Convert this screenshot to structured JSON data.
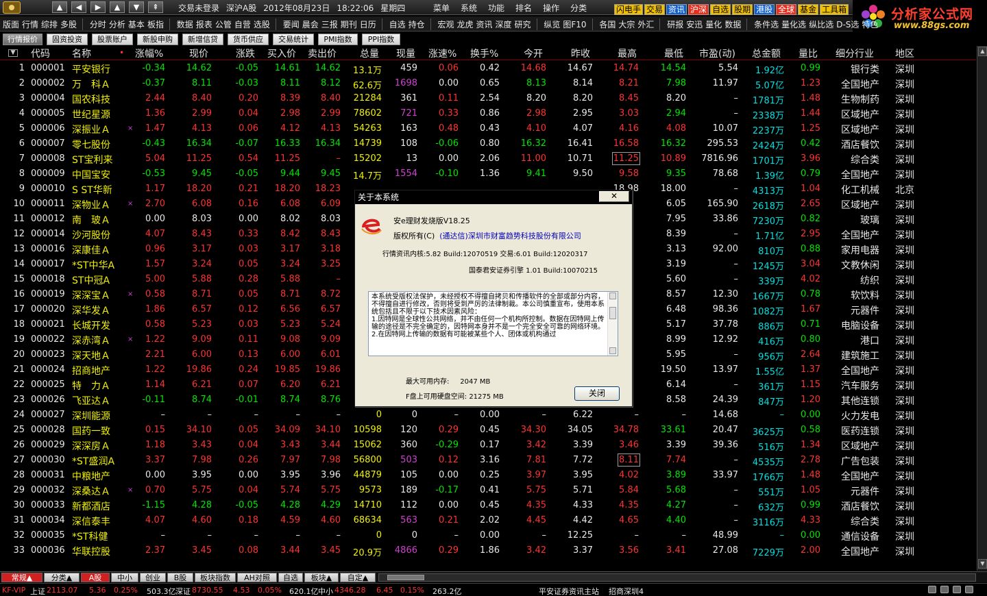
{
  "top": {
    "nav": [
      "▲",
      "◀",
      "▶",
      "▲",
      "▼",
      "⇞"
    ],
    "status": [
      "交易未登录",
      "深沪A股",
      "2012年08月23日",
      "18:22:06",
      "星期四"
    ],
    "menu": [
      "菜单",
      "系统",
      "功能",
      "排名",
      "操作",
      "分类"
    ],
    "quick": [
      "闪电手",
      "交易",
      "资讯",
      "沪深",
      "自选",
      "股期",
      "港股",
      "全球",
      "基金",
      "工具箱"
    ]
  },
  "brand": {
    "name": "分析家公式网",
    "url": "www.88gs.com",
    "logo_icon": "flower-logo-icon"
  },
  "toolbar": [
    [
      "版面",
      "行情",
      "综排",
      "多股"
    ],
    [
      "分时",
      "分析",
      "基本",
      "板指"
    ],
    [
      "数据",
      "报表",
      "公管",
      "自营",
      "选股"
    ],
    [
      "要闻",
      "晨会",
      "三报",
      "期刊",
      "日历"
    ],
    [
      "自选",
      "持仓"
    ],
    [
      "宏观",
      "龙虎",
      "资讯",
      "深度",
      "研究"
    ],
    [
      "纵览",
      "图F10"
    ],
    [
      "各国",
      "大宗",
      "外汇"
    ],
    [
      "研报",
      "安迅",
      "量化",
      "数据"
    ],
    [
      "条件选",
      "量化选",
      "纵比选",
      "D-S选",
      "特色"
    ]
  ],
  "tabs": [
    "行情报价",
    "固资投资",
    "股票账户",
    "新股申购",
    "新增信贷",
    "货币供应",
    "交易统计",
    "PMI指数",
    "PPI指数"
  ],
  "columns": [
    "代码",
    "名称",
    "涨幅%",
    "现价",
    "涨跌",
    "买入价",
    "卖出价",
    "总量",
    "现量",
    "涨速%",
    "换手%",
    "今开",
    "昨收",
    "最高",
    "最低",
    "市盈(动)",
    "总金额",
    "量比",
    "细分行业",
    "地区"
  ],
  "sort_indicator": "•",
  "rows": [
    {
      "i": "1",
      "code": "000001",
      "name": "平安银行",
      "pct": "-0.34",
      "price": "14.62",
      "chg": "-0.05",
      "buy": "14.61",
      "sell": "14.62",
      "vol": "13.1万",
      "cur": "459",
      "spd": "0.06",
      "turn": "0.42",
      "open": "14.68",
      "prev": "14.67",
      "high": "14.74",
      "low": "14.54",
      "pe": "5.54",
      "amt": "1.92亿",
      "vr": "0.99",
      "ind": "银行类",
      "reg": "深圳"
    },
    {
      "i": "2",
      "code": "000002",
      "name": "万　科Ａ",
      "pct": "-0.37",
      "price": "8.11",
      "chg": "-0.03",
      "buy": "8.11",
      "sell": "8.12",
      "vol": "62.6万",
      "cur": "1698",
      "spd": "0.00",
      "turn": "0.65",
      "open": "8.13",
      "prev": "8.14",
      "high": "8.21",
      "low": "7.98",
      "pe": "11.97",
      "amt": "5.07亿",
      "vr": "1.23",
      "ind": "全国地产",
      "reg": "深圳"
    },
    {
      "i": "3",
      "code": "000004",
      "name": "国农科技",
      "pct": "2.44",
      "price": "8.40",
      "chg": "0.20",
      "buy": "8.39",
      "sell": "8.40",
      "vol": "21284",
      "cur": "361",
      "spd": "0.11",
      "turn": "2.54",
      "open": "8.20",
      "prev": "8.20",
      "high": "8.45",
      "low": "8.20",
      "pe": "–",
      "amt": "1781万",
      "vr": "1.48",
      "ind": "生物制药",
      "reg": "深圳"
    },
    {
      "i": "4",
      "code": "000005",
      "name": "世纪星源",
      "pct": "1.36",
      "price": "2.99",
      "chg": "0.04",
      "buy": "2.98",
      "sell": "2.99",
      "vol": "78602",
      "cur": "721",
      "spd": "0.33",
      "turn": "0.86",
      "open": "2.98",
      "prev": "2.95",
      "high": "3.03",
      "low": "2.94",
      "pe": "–",
      "amt": "2338万",
      "vr": "1.44",
      "ind": "区域地产",
      "reg": "深圳"
    },
    {
      "i": "5",
      "code": "000006",
      "name": "深振业Ａ",
      "mark": "×",
      "pct": "1.47",
      "price": "4.13",
      "chg": "0.06",
      "buy": "4.12",
      "sell": "4.13",
      "vol": "54263",
      "cur": "163",
      "spd": "0.48",
      "turn": "0.43",
      "open": "4.10",
      "prev": "4.07",
      "high": "4.16",
      "low": "4.08",
      "pe": "10.07",
      "amt": "2237万",
      "vr": "1.25",
      "ind": "区域地产",
      "reg": "深圳"
    },
    {
      "i": "6",
      "code": "000007",
      "name": "零七股份",
      "pct": "-0.43",
      "price": "16.34",
      "chg": "-0.07",
      "buy": "16.33",
      "sell": "16.34",
      "vol": "14739",
      "cur": "108",
      "spd": "-0.06",
      "turn": "0.80",
      "open": "16.32",
      "prev": "16.41",
      "high": "16.58",
      "low": "16.32",
      "pe": "295.53",
      "amt": "2424万",
      "vr": "0.42",
      "ind": "酒店餐饮",
      "reg": "深圳"
    },
    {
      "i": "7",
      "code": "000008",
      "name": "ST宝利来",
      "pct": "5.04",
      "price": "11.25",
      "chg": "0.54",
      "buy": "11.25",
      "sell": "–",
      "vol": "15202",
      "cur": "13",
      "spd": "0.00",
      "turn": "2.06",
      "open": "11.00",
      "prev": "10.71",
      "high": "11.25",
      "low": "10.89",
      "pe": "7816.96",
      "amt": "1701万",
      "vr": "3.96",
      "ind": "综合类",
      "reg": "深圳"
    },
    {
      "i": "8",
      "code": "000009",
      "name": "中国宝安",
      "pct": "-0.53",
      "price": "9.45",
      "chg": "-0.05",
      "buy": "9.44",
      "sell": "9.45",
      "vol": "14.7万",
      "cur": "1554",
      "spd": "-0.10",
      "turn": "1.36",
      "open": "9.41",
      "prev": "9.50",
      "high": "9.58",
      "low": "9.35",
      "pe": "78.68",
      "amt": "1.39亿",
      "vr": "0.79",
      "ind": "全国地产",
      "reg": "深圳"
    },
    {
      "i": "9",
      "code": "000010",
      "name": "S ST华新",
      "pct": "1.17",
      "price": "18.20",
      "chg": "0.21",
      "buy": "18.20",
      "sell": "18.23",
      "vol": "",
      "cur": "",
      "spd": "",
      "turn": "",
      "open": "",
      "prev": "",
      "high": "18.98",
      "low": "18.00",
      "pe": "–",
      "amt": "4313万",
      "vr": "1.04",
      "ind": "化工机械",
      "reg": "北京"
    },
    {
      "i": "10",
      "code": "000011",
      "name": "深物业Ａ",
      "mark": "×",
      "pct": "2.70",
      "price": "6.08",
      "chg": "0.16",
      "buy": "6.08",
      "sell": "6.09",
      "vol": "",
      "cur": "",
      "spd": "",
      "turn": "",
      "open": "",
      "prev": "",
      "high": "",
      "low": "6.05",
      "pe": "165.90",
      "amt": "2618万",
      "vr": "2.65",
      "ind": "区域地产",
      "reg": "深圳"
    },
    {
      "i": "11",
      "code": "000012",
      "name": "南　玻Ａ",
      "pct": "0.00",
      "price": "8.03",
      "chg": "0.00",
      "buy": "8.02",
      "sell": "8.03",
      "vol": "",
      "cur": "",
      "spd": "",
      "turn": "",
      "open": "",
      "prev": "",
      "high": "",
      "low": "7.95",
      "pe": "33.86",
      "amt": "7230万",
      "vr": "0.82",
      "ind": "玻璃",
      "reg": "深圳"
    },
    {
      "i": "12",
      "code": "000014",
      "name": "沙河股份",
      "pct": "4.07",
      "price": "8.43",
      "chg": "0.33",
      "buy": "8.42",
      "sell": "8.43",
      "vol": "",
      "cur": "",
      "spd": "",
      "turn": "",
      "open": "",
      "prev": "",
      "high": "",
      "low": "8.39",
      "pe": "–",
      "amt": "1.71亿",
      "vr": "2.95",
      "ind": "全国地产",
      "reg": "深圳"
    },
    {
      "i": "13",
      "code": "000016",
      "name": "深康佳Ａ",
      "pct": "0.96",
      "price": "3.17",
      "chg": "0.03",
      "buy": "3.17",
      "sell": "3.18",
      "vol": "",
      "cur": "",
      "spd": "",
      "turn": "",
      "open": "",
      "prev": "",
      "high": "",
      "low": "3.13",
      "pe": "92.00",
      "amt": "810万",
      "vr": "0.88",
      "ind": "家用电器",
      "reg": "深圳"
    },
    {
      "i": "14",
      "code": "000017",
      "name": "*ST中华A",
      "pct": "1.57",
      "price": "3.24",
      "chg": "0.05",
      "buy": "3.24",
      "sell": "3.25",
      "vol": "",
      "cur": "",
      "spd": "",
      "turn": "",
      "open": "",
      "prev": "",
      "high": "",
      "low": "3.19",
      "pe": "–",
      "amt": "1245万",
      "vr": "3.04",
      "ind": "文教休闲",
      "reg": "深圳"
    },
    {
      "i": "15",
      "code": "000018",
      "name": "ST中冠A",
      "pct": "5.00",
      "price": "5.88",
      "chg": "0.28",
      "buy": "5.88",
      "sell": "–",
      "vol": "",
      "cur": "",
      "spd": "",
      "turn": "",
      "open": "",
      "prev": "",
      "high": "",
      "low": "5.60",
      "pe": "–",
      "amt": "339万",
      "vr": "4.02",
      "ind": "纺织",
      "reg": "深圳"
    },
    {
      "i": "16",
      "code": "000019",
      "name": "深深宝Ａ",
      "mark": "×",
      "pct": "0.58",
      "price": "8.71",
      "chg": "0.05",
      "buy": "8.71",
      "sell": "8.72",
      "vol": "",
      "cur": "",
      "spd": "",
      "turn": "",
      "open": "",
      "prev": "",
      "high": "",
      "low": "8.57",
      "pe": "12.30",
      "amt": "1667万",
      "vr": "0.78",
      "ind": "软饮料",
      "reg": "深圳"
    },
    {
      "i": "17",
      "code": "000020",
      "name": "深华发Ａ",
      "pct": "1.86",
      "price": "6.57",
      "chg": "0.12",
      "buy": "6.56",
      "sell": "6.57",
      "vol": "",
      "cur": "",
      "spd": "",
      "turn": "",
      "open": "",
      "prev": "",
      "high": "",
      "low": "6.48",
      "pe": "98.36",
      "amt": "1082万",
      "vr": "1.67",
      "ind": "元器件",
      "reg": "深圳"
    },
    {
      "i": "18",
      "code": "000021",
      "name": "长城开发",
      "pct": "0.58",
      "price": "5.23",
      "chg": "0.03",
      "buy": "5.23",
      "sell": "5.24",
      "vol": "",
      "cur": "",
      "spd": "",
      "turn": "",
      "open": "",
      "prev": "",
      "high": "",
      "low": "5.17",
      "pe": "37.78",
      "amt": "886万",
      "vr": "0.71",
      "ind": "电脑设备",
      "reg": "深圳"
    },
    {
      "i": "19",
      "code": "000022",
      "name": "深赤湾Ａ",
      "mark": "×",
      "pct": "1.22",
      "price": "9.09",
      "chg": "0.11",
      "buy": "9.08",
      "sell": "9.09",
      "vol": "",
      "cur": "",
      "spd": "",
      "turn": "",
      "open": "",
      "prev": "",
      "high": "",
      "low": "8.99",
      "pe": "12.92",
      "amt": "416万",
      "vr": "0.80",
      "ind": "港口",
      "reg": "深圳"
    },
    {
      "i": "20",
      "code": "000023",
      "name": "深天地Ａ",
      "pct": "2.21",
      "price": "6.00",
      "chg": "0.13",
      "buy": "6.00",
      "sell": "6.01",
      "vol": "",
      "cur": "",
      "spd": "",
      "turn": "",
      "open": "",
      "prev": "",
      "high": "",
      "low": "5.95",
      "pe": "–",
      "amt": "956万",
      "vr": "2.64",
      "ind": "建筑施工",
      "reg": "深圳"
    },
    {
      "i": "21",
      "code": "000024",
      "name": "招商地产",
      "pct": "1.22",
      "price": "19.86",
      "chg": "0.24",
      "buy": "19.85",
      "sell": "19.86",
      "vol": "",
      "cur": "",
      "spd": "",
      "turn": "",
      "open": "",
      "prev": "",
      "high": "",
      "low": "19.50",
      "pe": "13.97",
      "amt": "1.55亿",
      "vr": "1.37",
      "ind": "全国地产",
      "reg": "深圳"
    },
    {
      "i": "22",
      "code": "000025",
      "name": "特　力Ａ",
      "pct": "1.14",
      "price": "6.21",
      "chg": "0.07",
      "buy": "6.20",
      "sell": "6.21",
      "vol": "",
      "cur": "",
      "spd": "",
      "turn": "",
      "open": "",
      "prev": "",
      "high": "",
      "low": "6.14",
      "pe": "–",
      "amt": "361万",
      "vr": "1.15",
      "ind": "汽车服务",
      "reg": "深圳"
    },
    {
      "i": "23",
      "code": "000026",
      "name": "飞亚达Ａ",
      "pct": "-0.11",
      "price": "8.74",
      "chg": "-0.01",
      "buy": "8.74",
      "sell": "8.76",
      "vol": "",
      "cur": "",
      "spd": "",
      "turn": "",
      "open": "",
      "prev": "",
      "high": "",
      "low": "8.58",
      "pe": "24.39",
      "amt": "847万",
      "vr": "1.20",
      "ind": "其他连锁",
      "reg": "深圳"
    },
    {
      "i": "24",
      "code": "000027",
      "name": "深圳能源",
      "pct": "–",
      "price": "–",
      "chg": "–",
      "buy": "–",
      "sell": "–",
      "vol": "0",
      "cur": "0",
      "spd": "–",
      "turn": "0.00",
      "open": "–",
      "prev": "6.22",
      "high": "–",
      "low": "–",
      "pe": "14.68",
      "amt": "–",
      "vr": "0.00",
      "ind": "火力发电",
      "reg": "深圳"
    },
    {
      "i": "25",
      "code": "000028",
      "name": "国药一致",
      "pct": "0.15",
      "price": "34.10",
      "chg": "0.05",
      "buy": "34.09",
      "sell": "34.10",
      "vol": "10598",
      "cur": "120",
      "spd": "0.29",
      "turn": "0.45",
      "open": "34.30",
      "prev": "34.05",
      "high": "34.78",
      "low": "33.61",
      "pe": "20.47",
      "amt": "3625万",
      "vr": "0.58",
      "ind": "医药连锁",
      "reg": "深圳"
    },
    {
      "i": "26",
      "code": "000029",
      "name": "深深房Ａ",
      "pct": "1.18",
      "price": "3.43",
      "chg": "0.04",
      "buy": "3.43",
      "sell": "3.44",
      "vol": "15062",
      "cur": "360",
      "spd": "-0.29",
      "turn": "0.17",
      "open": "3.42",
      "prev": "3.39",
      "high": "3.46",
      "low": "3.39",
      "pe": "39.36",
      "amt": "516万",
      "vr": "1.34",
      "ind": "区域地产",
      "reg": "深圳"
    },
    {
      "i": "27",
      "code": "000030",
      "name": "*ST盛润A",
      "pct": "3.37",
      "price": "7.98",
      "chg": "0.26",
      "buy": "7.97",
      "sell": "7.98",
      "vol": "56800",
      "cur": "503",
      "spd": "0.12",
      "turn": "3.16",
      "open": "7.81",
      "prev": "7.72",
      "high": "8.11",
      "low": "7.74",
      "pe": "–",
      "amt": "4535万",
      "vr": "2.78",
      "ind": "广告包装",
      "reg": "深圳"
    },
    {
      "i": "28",
      "code": "000031",
      "name": "中粮地产",
      "pct": "0.00",
      "price": "3.95",
      "chg": "0.00",
      "buy": "3.95",
      "sell": "3.96",
      "vol": "44879",
      "cur": "105",
      "spd": "0.00",
      "turn": "0.25",
      "open": "3.97",
      "prev": "3.95",
      "high": "4.02",
      "low": "3.89",
      "pe": "33.97",
      "amt": "1766万",
      "vr": "1.48",
      "ind": "全国地产",
      "reg": "深圳"
    },
    {
      "i": "29",
      "code": "000032",
      "name": "深桑达Ａ",
      "mark": "×",
      "pct": "0.70",
      "price": "5.75",
      "chg": "0.04",
      "buy": "5.74",
      "sell": "5.75",
      "vol": "9573",
      "cur": "189",
      "spd": "-0.17",
      "turn": "0.41",
      "open": "5.75",
      "prev": "5.71",
      "high": "5.84",
      "low": "5.68",
      "pe": "–",
      "amt": "551万",
      "vr": "1.05",
      "ind": "元器件",
      "reg": "深圳"
    },
    {
      "i": "30",
      "code": "000033",
      "name": "新都酒店",
      "pct": "-1.15",
      "price": "4.28",
      "chg": "-0.05",
      "buy": "4.28",
      "sell": "4.29",
      "vol": "14710",
      "cur": "112",
      "spd": "0.00",
      "turn": "0.45",
      "open": "4.35",
      "prev": "4.33",
      "high": "4.35",
      "low": "4.27",
      "pe": "–",
      "amt": "632万",
      "vr": "0.99",
      "ind": "酒店餐饮",
      "reg": "深圳"
    },
    {
      "i": "31",
      "code": "000034",
      "name": "深信泰丰",
      "pct": "4.07",
      "price": "4.60",
      "chg": "0.18",
      "buy": "4.59",
      "sell": "4.60",
      "vol": "68634",
      "cur": "563",
      "spd": "0.21",
      "turn": "2.02",
      "open": "4.45",
      "prev": "4.42",
      "high": "4.65",
      "low": "4.40",
      "pe": "–",
      "amt": "3116万",
      "vr": "4.33",
      "ind": "综合类",
      "reg": "深圳"
    },
    {
      "i": "32",
      "code": "000035",
      "name": "*ST科健",
      "pct": "–",
      "price": "–",
      "chg": "–",
      "buy": "–",
      "sell": "–",
      "vol": "0",
      "cur": "0",
      "spd": "–",
      "turn": "0.00",
      "open": "–",
      "prev": "12.25",
      "high": "–",
      "low": "–",
      "pe": "48.99",
      "amt": "–",
      "vr": "0.00",
      "ind": "通信设备",
      "reg": "深圳"
    },
    {
      "i": "33",
      "code": "000036",
      "name": "华联控股",
      "pct": "2.37",
      "price": "3.45",
      "chg": "0.08",
      "buy": "3.44",
      "sell": "3.45",
      "vol": "20.9万",
      "cur": "4866",
      "spd": "0.29",
      "turn": "1.86",
      "open": "3.42",
      "prev": "3.37",
      "high": "3.56",
      "low": "3.41",
      "pe": "27.08",
      "amt": "7229万",
      "vr": "2.00",
      "ind": "全国地产",
      "reg": "深圳"
    }
  ],
  "bottom_tabs": [
    "常规▲",
    "分类▲",
    "A股",
    "中小",
    "创业",
    "B股",
    "板块指数",
    "AH对照",
    "自选",
    "板块▲",
    "自定▲"
  ],
  "status": {
    "vip": "KF-VIP",
    "sh_label": "上证",
    "sh_index": "2113.07",
    "sh_chg": "5.36",
    "sh_pct": "0.25%",
    "sh_amt": "503.3亿",
    "sz_label": "深证",
    "sz_index": "8730.55",
    "sz_chg": "4.53",
    "sz_pct": "0.05%",
    "sz_amt": "620.1亿",
    "zx_label": "中小",
    "zx_index": "4346.28",
    "zx_chg": "6.45",
    "zx_pct": "0.15%",
    "zx_amt": "263.2亿",
    "site": "平安证券资讯主站",
    "branch": "招商深圳4"
  },
  "dialog": {
    "title": "关于本系统",
    "close_x": "✕",
    "product": "安e理财发烧版V18.25",
    "copyright_label": "版权所有(C)",
    "company": "(通达信)深圳市财富趋势科技股份有限公司",
    "version_line1": "行情资讯内核:5.82 Build:12070519 交易:6.01 Build:12020317",
    "version_line2": "国泰君安证券引擎 1.01 Build:10070215",
    "notice": "本系统受版权法保护，未经授权不得擅自拷贝和传播软件的全部或部分内容，不得擅自进行修改，否则将受到严厉的法律制裁。本公司慎重宣布，使用本系统包括且不限于以下技术因素风险：\n1.因特网是全球性公共网络，并不由任何一个机构所控制。数据在因特网上传输的途径是不完全确定的，因特网本身并不是一个完全安全可靠的网络环境。\n2.在因特网上传输的数据有可能被某些个人、团体或机构通过",
    "mem_label": "最大可用内存:",
    "mem_value": "2047 MB",
    "disk_label": "F盘上可用硬盘空间:",
    "disk_value": "21275 MB",
    "close_button": "关闭"
  },
  "colors": {
    "up": "#ff3232",
    "down": "#00e600",
    "name": "#f0f000",
    "accent_red": "#d02020"
  }
}
